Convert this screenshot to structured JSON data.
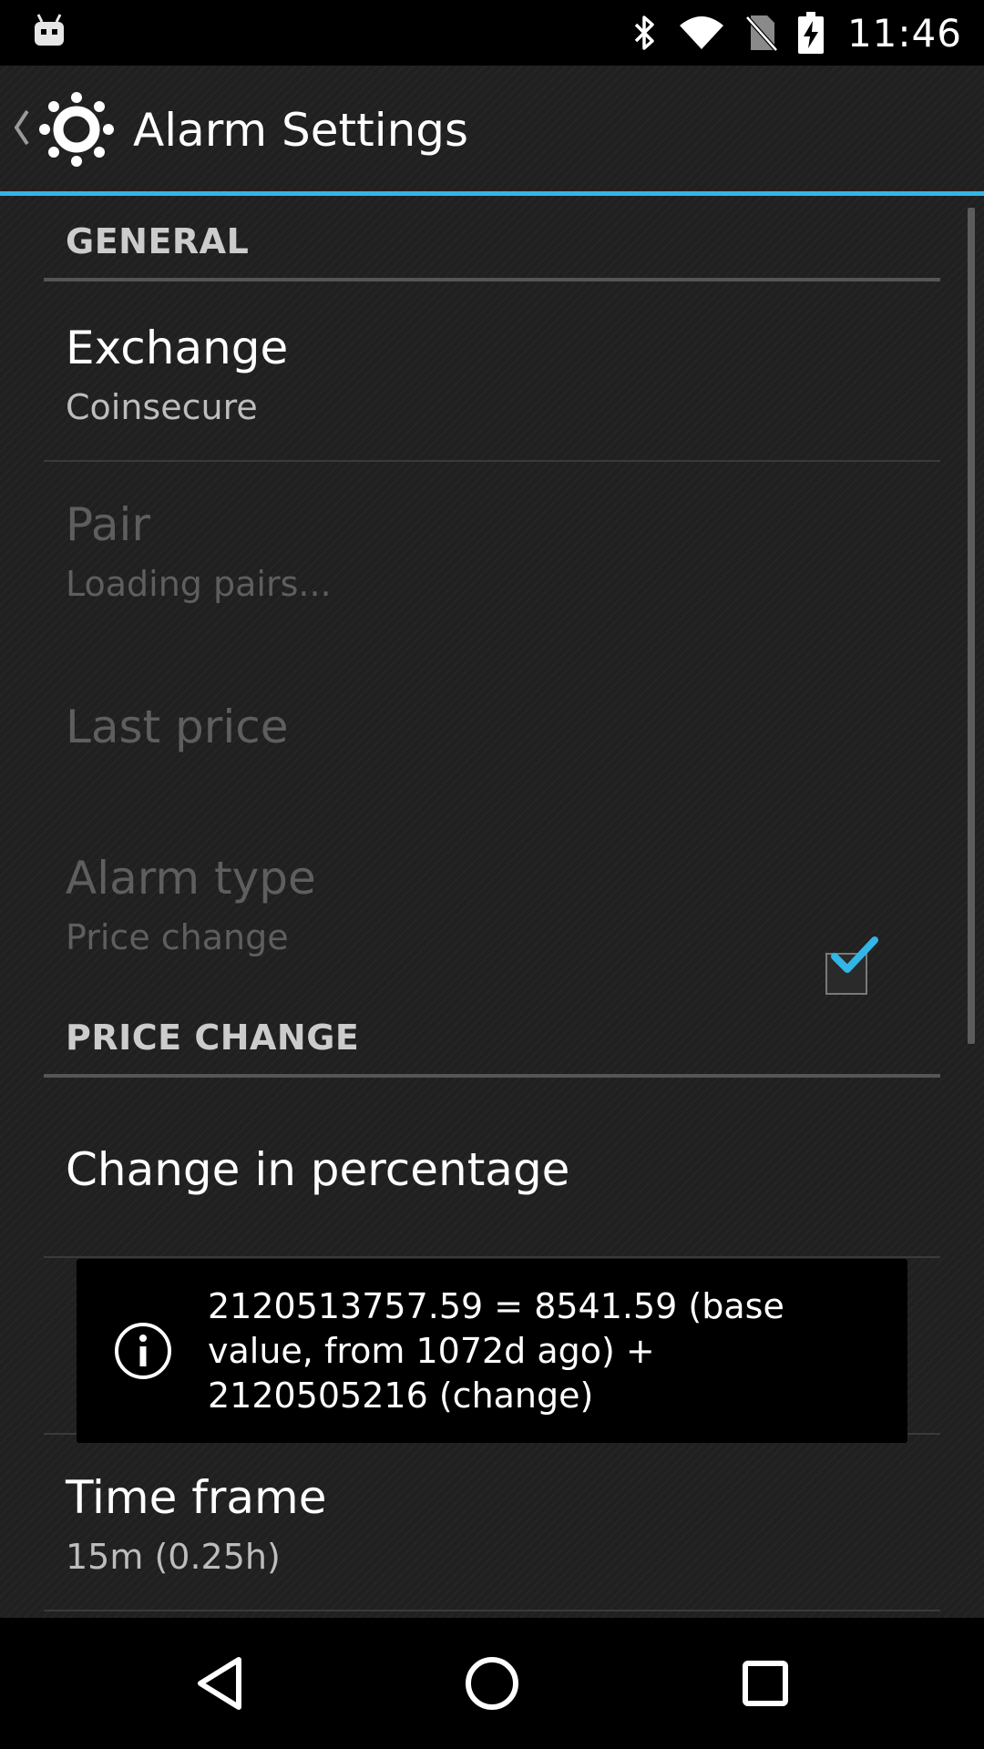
{
  "status_bar": {
    "time": "11:46",
    "icons": [
      "android-notification-icon",
      "bluetooth-icon",
      "wifi-icon",
      "no-sim-icon",
      "battery-charging-icon"
    ]
  },
  "action_bar": {
    "title": "Alarm Settings",
    "icons": [
      "back-chevron-icon",
      "app-gear-icon"
    ]
  },
  "preferences": {
    "general_header": "GENERAL",
    "exchange": {
      "title": "Exchange",
      "summary": "Coinsecure"
    },
    "pair": {
      "title": "Pair",
      "summary": "Loading pairs..."
    },
    "last_price": {
      "title": "Last price"
    },
    "alarm_type": {
      "title": "Alarm type",
      "summary": "Price change"
    },
    "price_change_header": "PRICE CHANGE",
    "change_in_percentage": {
      "title": "Change in percentage",
      "checked": true
    },
    "time_frame": {
      "title": "Time frame",
      "summary": "15m (0.25h)"
    }
  },
  "toast": {
    "text": "2120513757.59 = 8541.59 (base value, from 1072d ago) + 2120505216 (change)",
    "icon": "info-icon"
  },
  "nav_bar": {
    "buttons": [
      "back-nav-icon",
      "home-nav-icon",
      "recents-nav-icon"
    ]
  },
  "colors": {
    "accent": "#33b5e5",
    "background": "#202020",
    "status_bar": "#000000"
  }
}
